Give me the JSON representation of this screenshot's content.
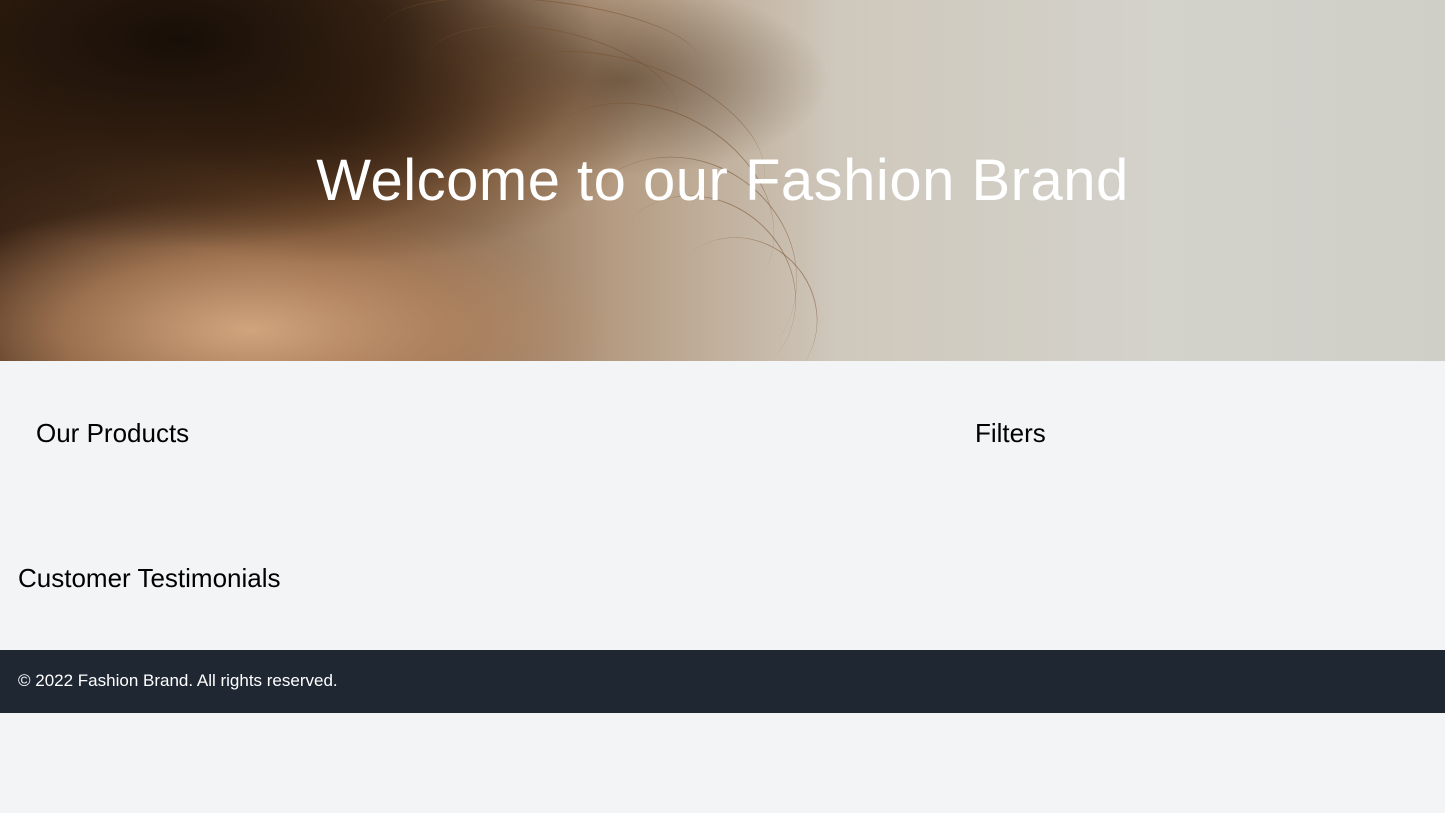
{
  "hero": {
    "title": "Welcome to our Fashion Brand"
  },
  "products": {
    "title": "Our Products"
  },
  "filters": {
    "title": "Filters"
  },
  "testimonials": {
    "title": "Customer Testimonials"
  },
  "footer": {
    "text": "© 2022 Fashion Brand. All rights reserved."
  },
  "colors": {
    "page_background": "#f3f4f6",
    "footer_background": "#1f2733",
    "hero_text": "#ffffff"
  }
}
